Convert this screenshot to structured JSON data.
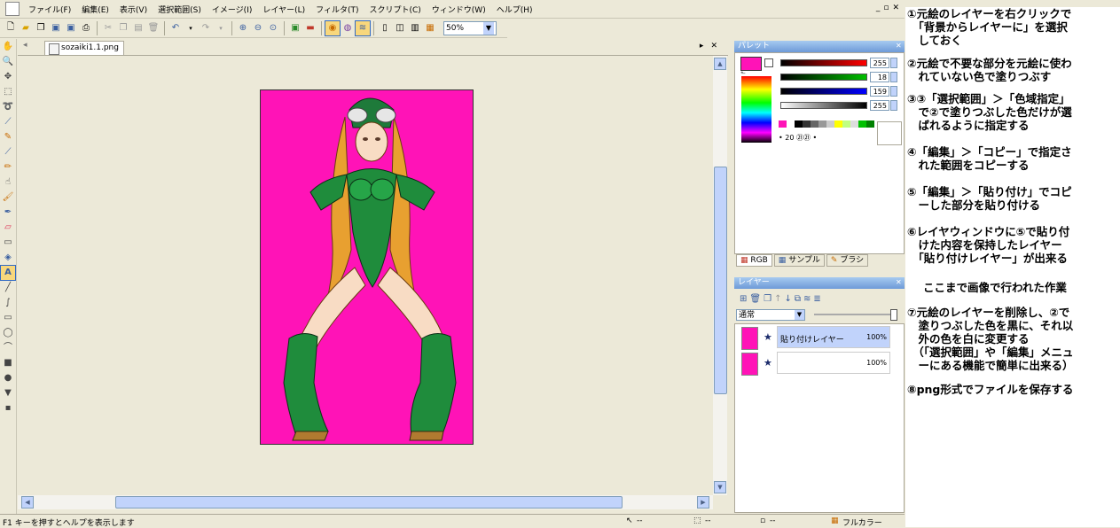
{
  "menu": [
    "ファイル(F)",
    "編集(E)",
    "表示(V)",
    "選択範囲(S)",
    "イメージ(I)",
    "レイヤー(L)",
    "フィルタ(T)",
    "スクリプト(C)",
    "ウィンドウ(W)",
    "ヘルプ(H)"
  ],
  "toolbar": {
    "zoom_value": "50%"
  },
  "document": {
    "tab_title": "sozaiki1.1.png",
    "canvas_color": "#ff13b7"
  },
  "palette": {
    "title": "パレット",
    "current_color": "#ff13b7",
    "channels": [
      {
        "name": "red",
        "value": "255",
        "color": "#ff0000"
      },
      {
        "name": "green",
        "value": "18",
        "color": "#00c000"
      },
      {
        "name": "blue",
        "value": "159",
        "color": "#0000ff"
      },
      {
        "name": "alpha",
        "value": "255",
        "color": "#000000"
      }
    ],
    "brush_sizes": "• 20 ㉑㉑ •",
    "tabs": [
      "RGB",
      "サンプル",
      "ブラシ"
    ]
  },
  "layers": {
    "title": "レイヤー",
    "blend_mode": "通常",
    "items": [
      {
        "name": "貼り付けレイヤー",
        "opacity": "100%",
        "selected": true
      },
      {
        "name": "",
        "opacity": "100%",
        "selected": false
      }
    ]
  },
  "status": {
    "help": "F1 キーを押すとヘルプを表示します",
    "pos": "--",
    "size": "--",
    "sel": "--",
    "color_mode": "フルカラー"
  },
  "notes": [
    "①元絵のレイヤーを右クリックで\n　「背景からレイヤーに」を選択\n　しておく",
    "②元絵で不要な部分を元絵に使わ\n　れていない色で塗りつぶす",
    "③③「選択範囲」＞「色域指定」\n　で②で塗りつぶした色だけが選\n　ばれるように指定する",
    "④「編集」＞「コピー」で指定さ\n　れた範囲をコピーする",
    "⑤「編集」＞「貼り付け」でコピ\n　ーした部分を貼り付ける",
    "⑥レイヤウィンドウに⑤で貼り付\n　けた内容を保持したレイヤー\n　「貼り付けレイヤー」が出来る",
    "ここまで画像で行われた作業",
    "⑦元絵のレイヤーを削除し、②で\n　塗りつぶした色を黒に、それ以\n　外の色を白に変更する\n　（「選択範囲」や「編集」メニュ\n　ーにある機能で簡単に出来る）",
    "⑧png形式でファイルを保存する"
  ]
}
